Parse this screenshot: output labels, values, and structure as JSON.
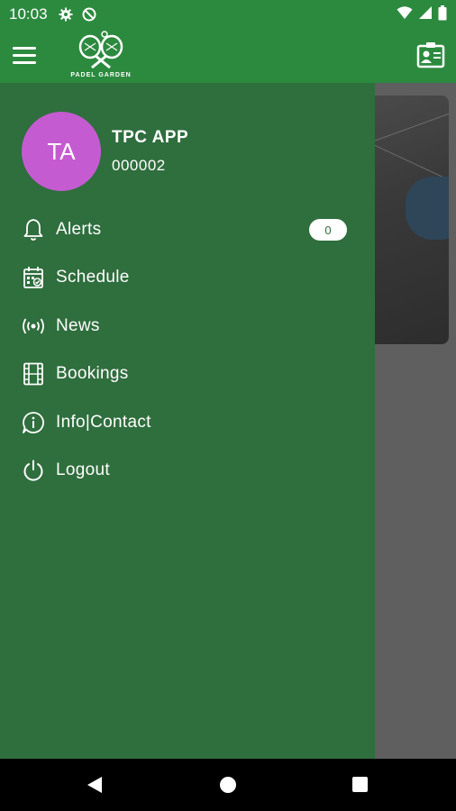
{
  "status_bar": {
    "time": "10:03",
    "icons_left": [
      "gear-icon",
      "no-disturb-icon"
    ],
    "icons_right": [
      "wifi-icon",
      "signal-icon",
      "battery-icon"
    ]
  },
  "app_bar": {
    "logo_text": "PADEL GARDEN",
    "menu_icon": "hamburger-icon",
    "action_icon": "id-card-icon"
  },
  "drawer": {
    "avatar_initials": "TA",
    "avatar_color": "#c55bd1",
    "user_name": "TPC APP",
    "user_id": "000002",
    "items": [
      {
        "label": "Alerts",
        "icon": "bell-icon",
        "badge": "0"
      },
      {
        "label": "Schedule",
        "icon": "calendar-check-icon"
      },
      {
        "label": "News",
        "icon": "broadcast-icon"
      },
      {
        "label": "Bookings",
        "icon": "film-strip-icon"
      },
      {
        "label": "Info|Contact",
        "icon": "info-chat-icon"
      },
      {
        "label": "Logout",
        "icon": "power-icon"
      }
    ]
  },
  "colors": {
    "primary": "#2c8a3f",
    "drawer": "#2f6e3d",
    "scrim": "#5f5f5f"
  }
}
